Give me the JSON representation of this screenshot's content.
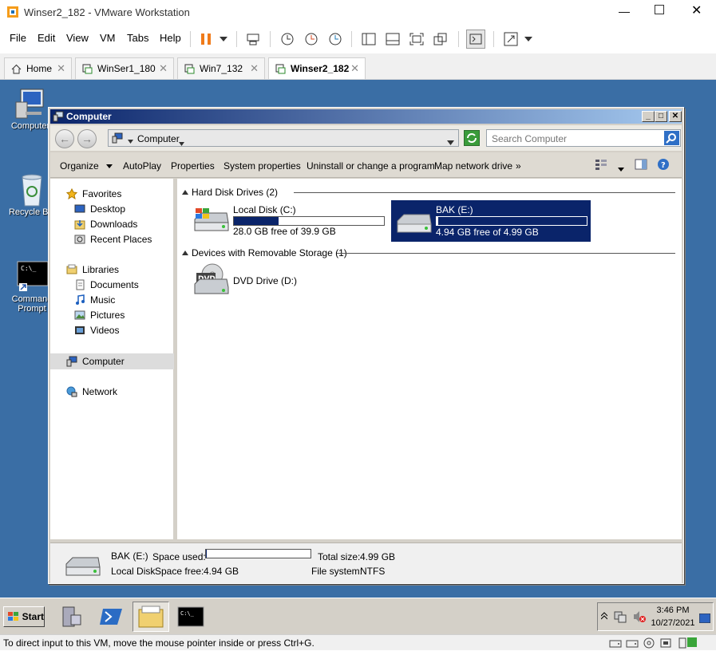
{
  "window": {
    "title": "Winser2_182 - VMware Workstation"
  },
  "menubar": {
    "items": [
      "File",
      "Edit",
      "View",
      "VM",
      "Tabs",
      "Help"
    ]
  },
  "tabs": [
    {
      "label": "Home",
      "active": false
    },
    {
      "label": "WinSer1_180",
      "active": false
    },
    {
      "label": "Win7_132",
      "active": false
    },
    {
      "label": "Winser2_182",
      "active": true
    }
  ],
  "desktop": {
    "icons": [
      {
        "label": "Computer",
        "icon": "computer-icon"
      },
      {
        "label": "Recycle Bin",
        "icon": "recycle-bin-icon"
      },
      {
        "label": "Command Prompt",
        "icon": "command-prompt-icon"
      }
    ]
  },
  "explorer": {
    "title": "Computer",
    "address": "Computer",
    "search_placeholder": "Search Computer",
    "toolbar": [
      "Organize",
      "AutoPlay",
      "Properties",
      "System properties",
      "Uninstall or change a program",
      "Map network drive",
      "»"
    ],
    "nav": {
      "favorites": {
        "label": "Favorites",
        "items": [
          "Desktop",
          "Downloads",
          "Recent Places"
        ]
      },
      "libraries": {
        "label": "Libraries",
        "items": [
          "Documents",
          "Music",
          "Pictures",
          "Videos"
        ]
      },
      "computer": "Computer",
      "network": "Network"
    },
    "groups": {
      "hdd": {
        "header": "Hard Disk Drives (2)",
        "drives": [
          {
            "name": "Local Disk (C:)",
            "free": "28.0 GB free of 39.9 GB",
            "used_fraction": 0.3,
            "selected": false
          },
          {
            "name": "BAK (E:)",
            "free": "4.94 GB free of 4.99 GB",
            "used_fraction": 0.01,
            "selected": true
          }
        ]
      },
      "removable": {
        "header": "Devices with Removable Storage (1)",
        "drives": [
          {
            "name": "DVD Drive (D:)"
          }
        ]
      }
    },
    "details": {
      "name": "BAK (E:)",
      "type": "Local Disk",
      "space_used_label": "Space used:",
      "space_free_label": "Space free:",
      "space_free": "4.94 GB",
      "total_size_label": "Total size:",
      "total_size": "4.99 GB",
      "file_system_label": "File system:",
      "file_system": "NTFS",
      "used_fraction": 0.01
    }
  },
  "taskbar": {
    "start": "Start",
    "time": "3:46 PM",
    "date": "10/27/2021"
  },
  "status": {
    "text": "To direct input to this VM, move the mouse pointer inside or press Ctrl+G."
  },
  "colors": {
    "desktop": "#3a6ea5",
    "selection": "#0a246a",
    "pause": "#f07b1a"
  }
}
